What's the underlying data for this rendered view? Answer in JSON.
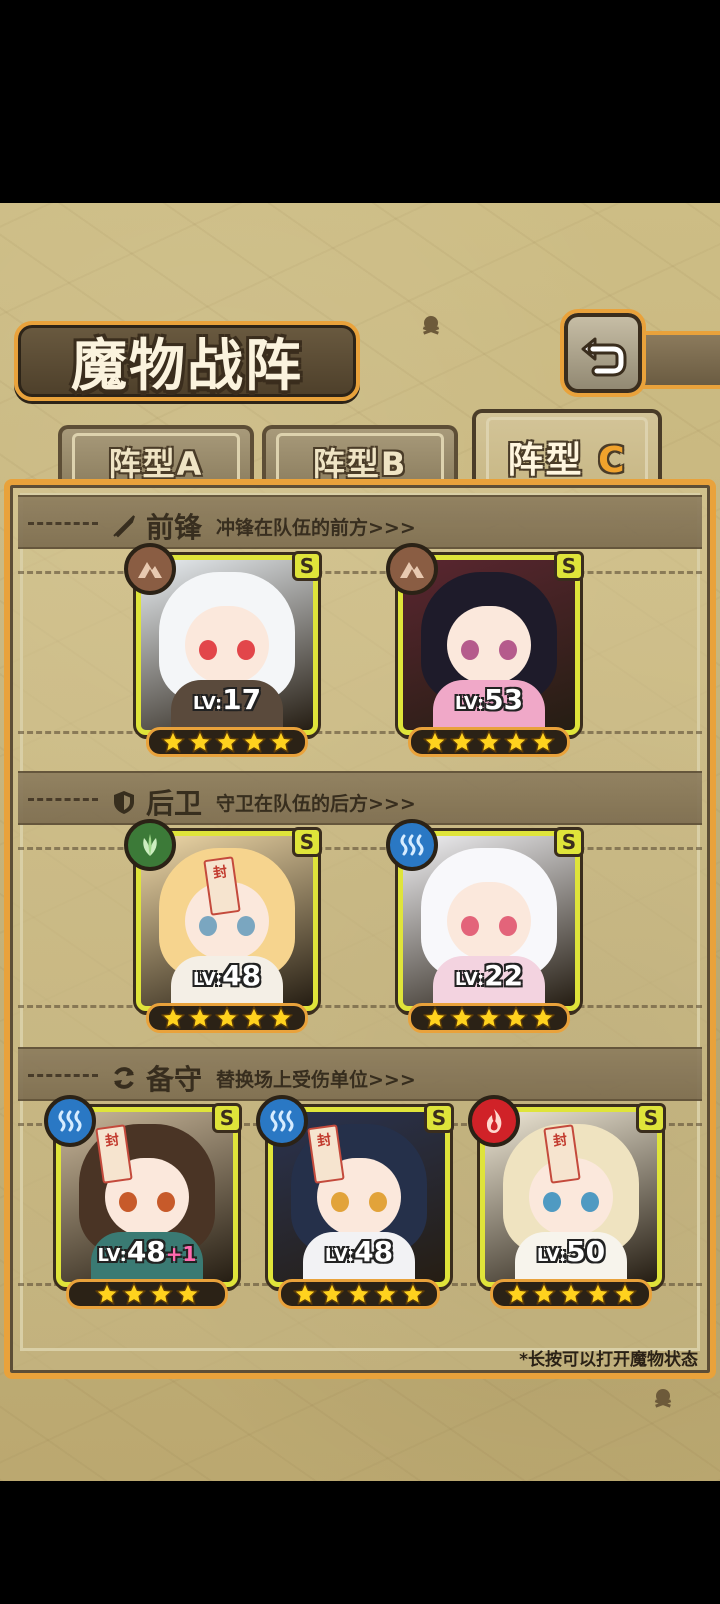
{
  "title": "魔物战阵",
  "tabs": [
    {
      "prefix": "阵型",
      "letter": "A",
      "active": false
    },
    {
      "prefix": "阵型",
      "letter": "B",
      "active": false
    },
    {
      "prefix": "阵型",
      "letter": "C",
      "active": true
    }
  ],
  "sections": [
    {
      "title": "前锋",
      "subtitle": "冲锋在队伍的前方>>>",
      "icon": "sword-icon"
    },
    {
      "title": "后卫",
      "subtitle": "守卫在队伍的后方>>>",
      "icon": "shield-icon"
    },
    {
      "title": "备守",
      "subtitle": "替换场上受伤单位>>>",
      "icon": "swap-icon"
    }
  ],
  "units": {
    "vanguard": [
      {
        "level_prefix": "LV:",
        "level": "17",
        "rank": "S",
        "element": "earth",
        "stars": 5
      },
      {
        "level_prefix": "LV:",
        "level": "53",
        "rank": "S",
        "element": "earth",
        "stars": 5
      }
    ],
    "rearguard": [
      {
        "level_prefix": "LV:",
        "level": "48",
        "rank": "S",
        "element": "wood",
        "stars": 5
      },
      {
        "level_prefix": "LV:",
        "level": "22",
        "rank": "S",
        "element": "water",
        "stars": 5
      }
    ],
    "reserve": [
      {
        "level_prefix": "LV:",
        "level": "48",
        "bonus": "+1",
        "rank": "S",
        "element": "water",
        "stars": 4
      },
      {
        "level_prefix": "LV:",
        "level": "48",
        "rank": "S",
        "element": "water",
        "stars": 5
      },
      {
        "level_prefix": "LV:",
        "level": "50",
        "rank": "S",
        "element": "fire",
        "stars": 5
      }
    ]
  },
  "seal_tag_text": "封",
  "footnote": "*长按可以打开魔物状态",
  "colors": {
    "frame_gold": "#e9a23b",
    "card_border": "#dfe43a",
    "star": "#ffd21e",
    "tab_accent": "#f0a22c"
  }
}
